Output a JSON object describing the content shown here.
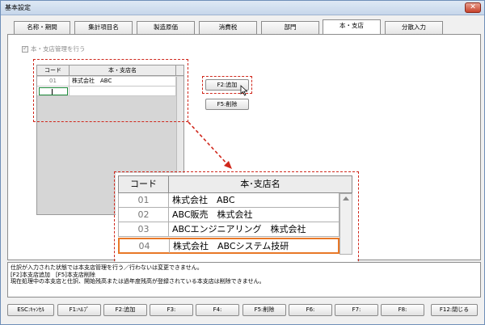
{
  "window": {
    "title": "基本設定",
    "close_glyph": "✕"
  },
  "tabs": [
    {
      "label": "名称・期間"
    },
    {
      "label": "集計項目名"
    },
    {
      "label": "製造原価"
    },
    {
      "label": "消費税"
    },
    {
      "label": "部門"
    },
    {
      "label": "本・支店",
      "active": true
    },
    {
      "label": "分散入力"
    }
  ],
  "branch_toggle": {
    "label": "本・支店管理を行う",
    "checked": true
  },
  "small_grid": {
    "headers": [
      "コード",
      "本・支店名"
    ],
    "rows": [
      {
        "code": "01",
        "name": "株式会社　ABC"
      }
    ]
  },
  "buttons": {
    "add": "F2:追加",
    "delete": "F5:削除"
  },
  "zoom_grid": {
    "headers": [
      "コード",
      "本･支店名"
    ],
    "rows": [
      {
        "code": "01",
        "name": "株式会社　ABC"
      },
      {
        "code": "02",
        "name": "ABC販売　株式会社"
      },
      {
        "code": "03",
        "name": "ABCエンジニアリング　株式会社"
      },
      {
        "code": "04",
        "name": "株式会社　ABCシステム技研"
      }
    ]
  },
  "messages": [
    "仕訳が入力された状態では本支店管理を行う／行わないは変更できません。",
    "[F2]本支店追加　[F5]本支店削除",
    "現在処理中の本支店と仕訳、開始残高または過年度残高が登録されている本支店は削除できません。"
  ],
  "function_keys": [
    "ESC:ｷｬﾝｾﾙ",
    "F1:ﾍﾙﾌﾟ",
    "F2:追加",
    "F3:",
    "F4:",
    "F5:削除",
    "F6:",
    "F7:",
    "F8:",
    "F12:閉じる"
  ],
  "colors": {
    "callout_border": "#d0281c",
    "highlight_row": "#e87828",
    "edit_cell": "#1c8a3a"
  },
  "icons": {
    "cursor": "mouse-pointer-icon",
    "scroll_up": "scroll-up-arrow-icon",
    "checkbox": "checkmark-icon"
  }
}
